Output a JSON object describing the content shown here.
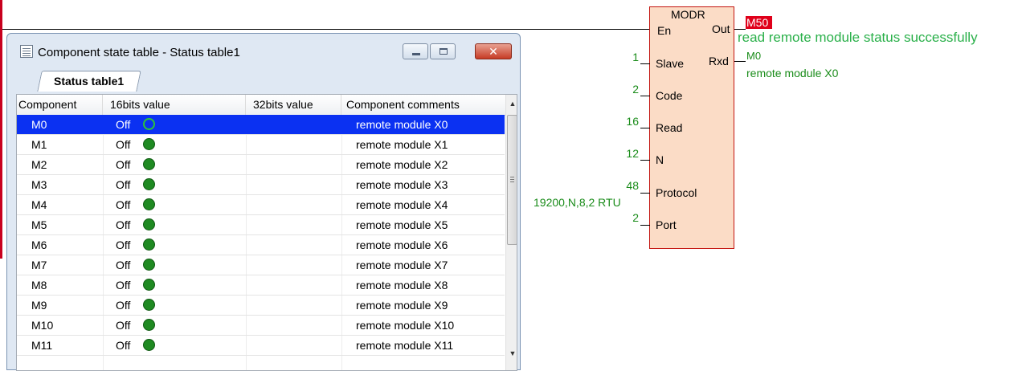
{
  "ladder": {
    "block_name": "MODR",
    "en_label": "En",
    "out_label": "Out",
    "rxd_label": "Rxd",
    "pins": [
      {
        "label": "Slave",
        "value": "1"
      },
      {
        "label": "Code",
        "value": "2"
      },
      {
        "label": "Read",
        "value": "16"
      },
      {
        "label": "N",
        "value": "12"
      },
      {
        "label": "Protocol",
        "value": "48"
      },
      {
        "label": "Port",
        "value": "2"
      }
    ],
    "protocol_comment": "19200,N,8,2 RTU",
    "out_device": "M50",
    "out_comment": "read remote module status successfully",
    "rxd_device": "M0",
    "rxd_comment": "remote module X0"
  },
  "window": {
    "title": "Component state table - Status table1",
    "tab_label": "Status table1",
    "columns": [
      "Component",
      "16bits value",
      "32bits value",
      "Component comments"
    ],
    "rows": [
      {
        "component": "M0",
        "value16": "Off",
        "value32": "",
        "comment": "remote module X0",
        "selected": true
      },
      {
        "component": "M1",
        "value16": "Off",
        "value32": "",
        "comment": "remote module X1"
      },
      {
        "component": "M2",
        "value16": "Off",
        "value32": "",
        "comment": "remote module X2"
      },
      {
        "component": "M3",
        "value16": "Off",
        "value32": "",
        "comment": "remote module X3"
      },
      {
        "component": "M4",
        "value16": "Off",
        "value32": "",
        "comment": "remote module X4"
      },
      {
        "component": "M5",
        "value16": "Off",
        "value32": "",
        "comment": "remote module X5"
      },
      {
        "component": "M6",
        "value16": "Off",
        "value32": "",
        "comment": "remote module X6"
      },
      {
        "component": "M7",
        "value16": "Off",
        "value32": "",
        "comment": "remote module X7"
      },
      {
        "component": "M8",
        "value16": "Off",
        "value32": "",
        "comment": "remote module X8"
      },
      {
        "component": "M9",
        "value16": "Off",
        "value32": "",
        "comment": "remote module X9"
      },
      {
        "component": "M10",
        "value16": "Off",
        "value32": "",
        "comment": "remote module X10"
      },
      {
        "component": "M11",
        "value16": "Off",
        "value32": "",
        "comment": "remote module X11"
      }
    ]
  },
  "colors": {
    "rail": "#c8001e",
    "block_fill": "#fbdcc6",
    "comment_green": "#1a8c1a",
    "selection_blue": "#0b31f2",
    "led_green": "#1f8a22"
  },
  "icons": [
    "table-icon",
    "minimize-icon",
    "maximize-icon",
    "close-icon",
    "status-led-icon",
    "scroll-up-icon",
    "scroll-down-icon"
  ]
}
